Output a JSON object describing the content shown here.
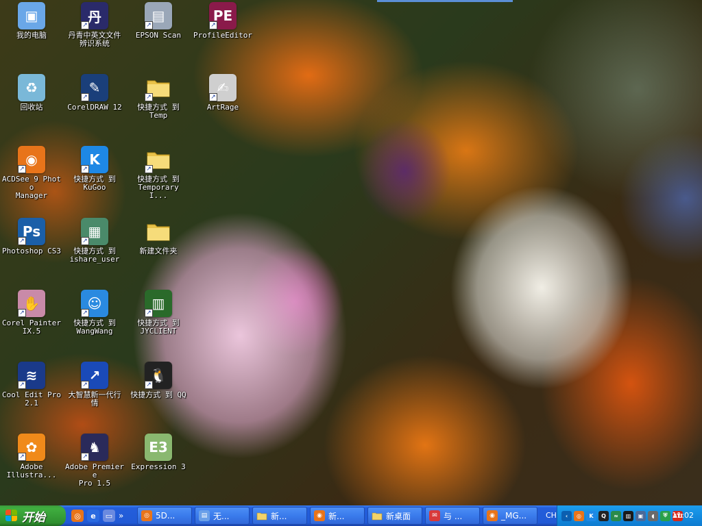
{
  "desktop": {
    "icons": [
      {
        "label": "我的电脑",
        "icon": "my-computer-icon",
        "shortcut": false,
        "color": "#6aa7e8",
        "glyph": "▣"
      },
      {
        "label": "丹青中英文文件\n辨识系统",
        "icon": "danqing-ocr-icon",
        "shortcut": true,
        "color": "#2a2a6a",
        "glyph": "丹"
      },
      {
        "label": "EPSON Scan",
        "icon": "scanner-icon",
        "shortcut": true,
        "color": "#9aa7b8",
        "glyph": "▤"
      },
      {
        "label": "ProfileEditor",
        "icon": "profile-editor-icon",
        "shortcut": true,
        "color": "#8a1a4a",
        "glyph": "PE"
      },
      {
        "label": "回收站",
        "icon": "recycle-bin-icon",
        "shortcut": false,
        "color": "#7ab8d8",
        "glyph": "♻"
      },
      {
        "label": "CorelDRAW 12",
        "icon": "coreldraw-icon",
        "shortcut": true,
        "color": "#1a3f7a",
        "glyph": "✎"
      },
      {
        "label": "快捷方式 到\nTemp",
        "icon": "folder-icon",
        "shortcut": true,
        "color": "#f2d36b",
        "glyph": ""
      },
      {
        "label": "ArtRage",
        "icon": "artrage-icon",
        "shortcut": true,
        "color": "#cfcfcf",
        "glyph": "✍"
      },
      {
        "label": "ACDSee 9 Photo\nManager",
        "icon": "acdsee-icon",
        "shortcut": true,
        "color": "#e8741a",
        "glyph": "◉"
      },
      {
        "label": "快捷方式 到\nKuGoo",
        "icon": "kugoo-icon",
        "shortcut": true,
        "color": "#1e88e5",
        "glyph": "K"
      },
      {
        "label": "快捷方式 到\nTemporary I...",
        "icon": "folder-icon",
        "shortcut": true,
        "color": "#f2d36b",
        "glyph": ""
      },
      {
        "label": "Photoshop CS3",
        "icon": "photoshop-icon",
        "shortcut": true,
        "color": "#1b5fa8",
        "glyph": "Ps"
      },
      {
        "label": "快捷方式 到\nishare_user",
        "icon": "network-computer-icon",
        "shortcut": true,
        "color": "#4a8a6a",
        "glyph": "▦"
      },
      {
        "label": "新建文件夹",
        "icon": "folder-icon",
        "shortcut": false,
        "color": "#f2d36b",
        "glyph": ""
      },
      {
        "label": "Corel Painter\nIX.5",
        "icon": "painter-icon",
        "shortcut": true,
        "color": "#c98aa8",
        "glyph": "✋"
      },
      {
        "label": "快捷方式 到\nWangWang",
        "icon": "wangwang-icon",
        "shortcut": true,
        "color": "#2a8ae0",
        "glyph": "☺"
      },
      {
        "label": "快捷方式 到\nJYCLIENT",
        "icon": "jyclient-icon",
        "shortcut": true,
        "color": "#2a6a2a",
        "glyph": "▥"
      },
      {
        "label": "Cool Edit Pro\n2.1",
        "icon": "cool-edit-icon",
        "shortcut": true,
        "color": "#1a3a8a",
        "glyph": "≋"
      },
      {
        "label": "大智慧新一代行\n情",
        "icon": "dazhihui-icon",
        "shortcut": true,
        "color": "#1a4ab8",
        "glyph": "↗"
      },
      {
        "label": "快捷方式 到 QQ",
        "icon": "qq-icon",
        "shortcut": true,
        "color": "#222222",
        "glyph": "🐧"
      },
      {
        "label": "Adobe\nIllustra...",
        "icon": "illustrator-icon",
        "shortcut": true,
        "color": "#f08a1a",
        "glyph": "✿"
      },
      {
        "label": "Adobe Premiere\nPro 1.5",
        "icon": "premiere-icon",
        "shortcut": true,
        "color": "#2a2a5a",
        "glyph": "♞"
      },
      {
        "label": "Expression 3",
        "icon": "expression-icon",
        "shortcut": false,
        "color": "#8ab870",
        "glyph": "E3"
      }
    ]
  },
  "taskbar": {
    "start_label": "开始",
    "quick_launch": [
      {
        "icon": "firefox-icon",
        "color": "#e8741a",
        "glyph": "◎"
      },
      {
        "icon": "ie-icon",
        "color": "#2a6ae0",
        "glyph": "e"
      },
      {
        "icon": "show-desktop-icon",
        "color": "#6a8ae0",
        "glyph": "▭"
      }
    ],
    "quick_launch_more": "»",
    "tasks": [
      {
        "label": "5D...",
        "icon": "firefox-icon",
        "color": "#e8741a",
        "glyph": "◎"
      },
      {
        "label": "无...",
        "icon": "document-icon",
        "color": "#6aa0e8",
        "glyph": "▤"
      },
      {
        "label": "新...",
        "icon": "folder-icon",
        "color": "#f2d36b",
        "glyph": ""
      },
      {
        "label": "新...",
        "icon": "acdsee-icon",
        "color": "#e8741a",
        "glyph": "◉"
      },
      {
        "label": "新桌面",
        "icon": "folder-icon",
        "color": "#f2d36b",
        "glyph": ""
      },
      {
        "label": "与 ...",
        "icon": "chat-icon",
        "color": "#d83a3a",
        "glyph": "✉"
      },
      {
        "label": "_MG...",
        "icon": "acdsee-icon",
        "color": "#e8741a",
        "glyph": "◉"
      }
    ],
    "language": "CH",
    "tray_icons": [
      {
        "icon": "back-arrow-icon",
        "color": "#0b5fb0",
        "glyph": "‹"
      },
      {
        "icon": "firefox-tray-icon",
        "color": "#e8741a",
        "glyph": "◎"
      },
      {
        "icon": "kugoo-tray-icon",
        "color": "#1e88e5",
        "glyph": "K"
      },
      {
        "icon": "qq-tray-icon",
        "color": "#222222",
        "glyph": "Q"
      },
      {
        "icon": "network-tray-icon",
        "color": "#2a8a4a",
        "glyph": "≈"
      },
      {
        "icon": "chart-tray-icon",
        "color": "#1a1a1a",
        "glyph": "▥"
      },
      {
        "icon": "monitor-tray-icon",
        "color": "#4a6a9a",
        "glyph": "▣"
      },
      {
        "icon": "volume-tray-icon",
        "color": "#6a6a6a",
        "glyph": "◖"
      },
      {
        "icon": "shield-tray-icon",
        "color": "#2aa04a",
        "glyph": "⛨"
      },
      {
        "icon": "ati-tray-icon",
        "color": "#d8281a",
        "glyph": "ATI"
      }
    ],
    "clock": "11:02"
  }
}
